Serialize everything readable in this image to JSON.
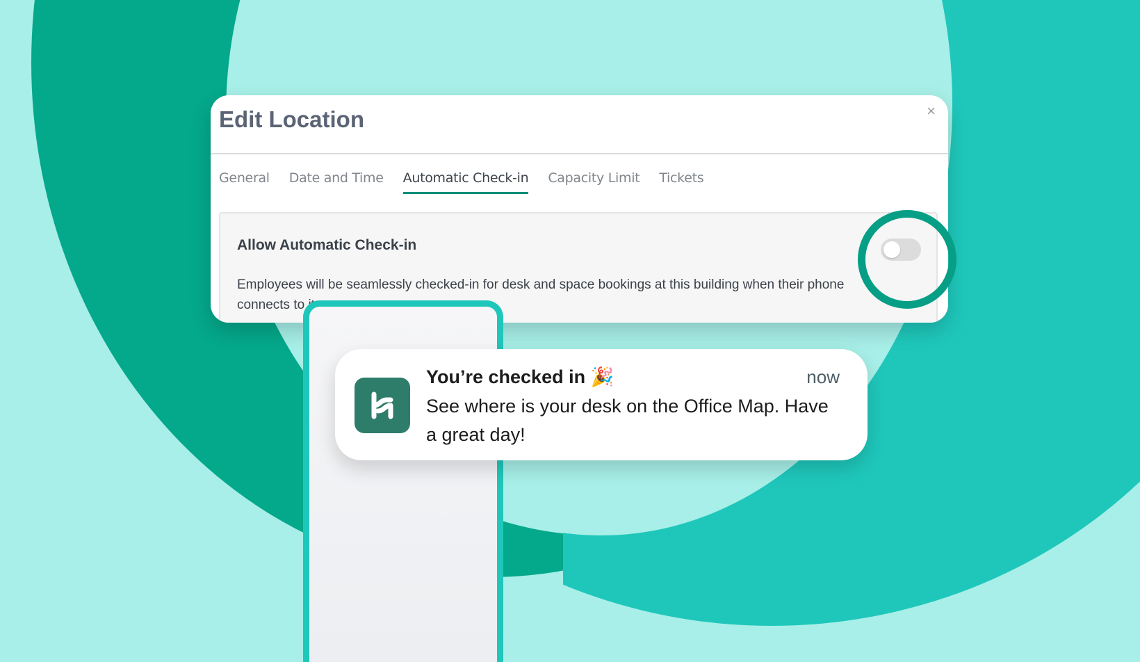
{
  "modal": {
    "title": "Edit Location",
    "close_symbol": "×",
    "tabs": [
      {
        "label": "General",
        "active": false
      },
      {
        "label": "Date and Time",
        "active": false
      },
      {
        "label": "Automatic Check-in",
        "active": true
      },
      {
        "label": "Capacity Limit",
        "active": false
      },
      {
        "label": "Tickets",
        "active": false
      }
    ],
    "setting": {
      "title": "Allow Automatic Check-in",
      "description": "Employees will be seamlessly checked-in for desk and space bookings at this building when their phone connects to it",
      "toggle_on": false
    }
  },
  "notification": {
    "title": "You’re checked in 🎉",
    "time": "now",
    "body": "See where is your desk on the Office Map. Have a great day!",
    "app_icon": "app-logo-icon"
  },
  "colors": {
    "background": "#a7efe8",
    "dark_green": "#04a88b",
    "teal": "#1fc7bb",
    "accent": "#069f86",
    "app_icon_bg": "#2e7d6b"
  }
}
